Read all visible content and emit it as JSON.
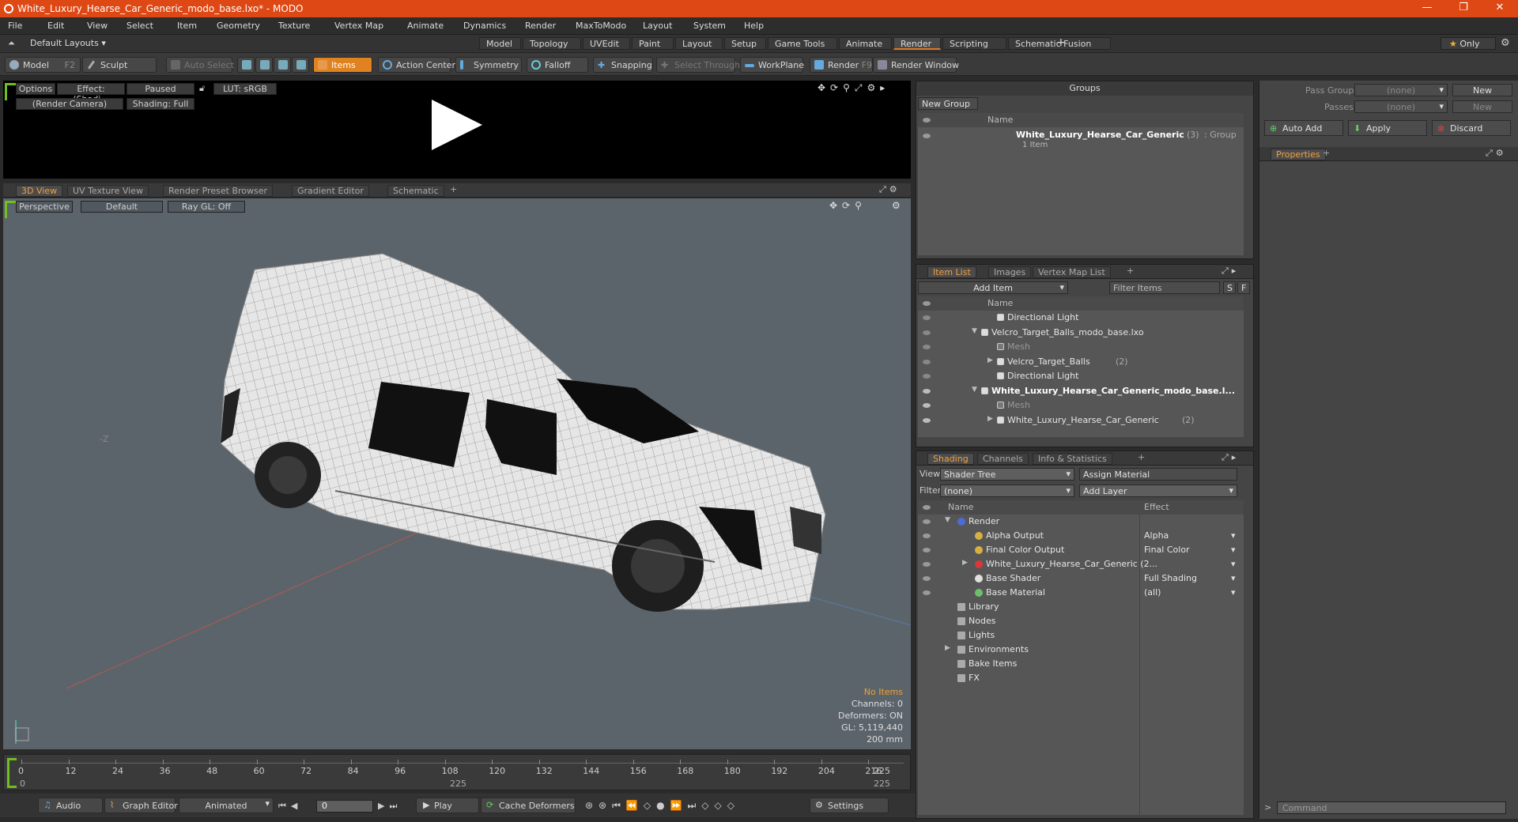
{
  "window": {
    "title": "White_Luxury_Hearse_Car_Generic_modo_base.lxo* - MODO",
    "min": "—",
    "max": "❐",
    "close": "✕"
  },
  "menu": [
    "File",
    "Edit",
    "View",
    "Select",
    "Item",
    "Geometry",
    "Texture",
    "Vertex Map",
    "Animate",
    "Dynamics",
    "Render",
    "MaxToModo",
    "Layout",
    "System",
    "Help"
  ],
  "layouts": {
    "label": "Default Layouts",
    "tabs": [
      "Model",
      "Topology",
      "UVEdit",
      "Paint",
      "Layout",
      "Setup",
      "Game Tools",
      "Animate",
      "Render",
      "Scripting",
      "Schematic Fusion"
    ],
    "active": "Render",
    "add": "+",
    "only": "Only"
  },
  "toolbar": {
    "model": "Model",
    "model_key": "F2",
    "sculpt": "Sculpt",
    "auto_select": "Auto Select",
    "items": "Items",
    "action_center": "Action Center",
    "symmetry": "Symmetry",
    "falloff": "Falloff",
    "snapping": "Snapping",
    "select_through": "Select Through",
    "workplane": "WorkPlane",
    "render": "Render",
    "render_key": "F9",
    "render_window": "Render Window"
  },
  "render_preview": {
    "options": "Options",
    "effect": "Effect: (Shadi...",
    "paused": "Paused",
    "lut": "LUT: sRGB",
    "camera": "(Render Camera)",
    "shading": "Shading: Full"
  },
  "view_tabs": [
    "3D View",
    "UV Texture View",
    "Render Preset Browser",
    "Gradient Editor",
    "Schematic"
  ],
  "viewport": {
    "perspective": "Perspective",
    "default": "Default",
    "raygl": "Ray GL: Off",
    "no_items": "No Items",
    "channels": "Channels: 0",
    "deformers": "Deformers: ON",
    "gl": "GL: 5,119,440",
    "scale": "200 mm",
    "axis_z": "-Z"
  },
  "timeline": {
    "ticks": [
      "0",
      "12",
      "24",
      "36",
      "48",
      "60",
      "72",
      "84",
      "96",
      "108",
      "120",
      "132",
      "144",
      "156",
      "168",
      "180",
      "192",
      "204",
      "216"
    ],
    "end_top": "225",
    "end_bot": "225",
    "end_mid": "225",
    "start": "0"
  },
  "bottombar": {
    "audio": "Audio",
    "graph_editor": "Graph Editor",
    "animated": "Animated",
    "frame": "0",
    "play": "Play",
    "cache": "Cache Deformers",
    "settings": "Settings"
  },
  "groups": {
    "title": "Groups",
    "new_group": "New Group",
    "name_col": "Name",
    "item_name": "White_Luxury_Hearse_Car_Generic",
    "item_count": "(3)",
    "item_type": ": Group",
    "item_sub": "1 Item"
  },
  "itemlist": {
    "tabs": [
      "Item List",
      "Images",
      "Vertex Map List"
    ],
    "add_item": "Add Item",
    "filter": "Filter Items",
    "s": "S",
    "f": "F",
    "name_col": "Name",
    "rows": [
      {
        "label": "Directional Light",
        "indent": 2,
        "bold": false,
        "dim": false,
        "suffix": ""
      },
      {
        "label": "Velcro_Target_Balls_modo_base.lxo",
        "indent": 1,
        "bold": false,
        "dim": false,
        "suffix": ""
      },
      {
        "label": "Mesh",
        "indent": 2,
        "bold": false,
        "dim": true,
        "suffix": ""
      },
      {
        "label": "Velcro_Target_Balls",
        "indent": 2,
        "bold": false,
        "dim": false,
        "suffix": "(2)"
      },
      {
        "label": "Directional Light",
        "indent": 2,
        "bold": false,
        "dim": false,
        "suffix": ""
      },
      {
        "label": "White_Luxury_Hearse_Car_Generic_modo_base.l...",
        "indent": 1,
        "bold": true,
        "dim": false,
        "suffix": ""
      },
      {
        "label": "Mesh",
        "indent": 2,
        "bold": false,
        "dim": true,
        "suffix": ""
      },
      {
        "label": "White_Luxury_Hearse_Car_Generic",
        "indent": 2,
        "bold": false,
        "dim": false,
        "suffix": "(2)"
      }
    ]
  },
  "shading": {
    "tabs": [
      "Shading",
      "Channels",
      "Info & Statistics"
    ],
    "view_label": "View",
    "view_value": "Shader Tree",
    "assign": "Assign Material",
    "filter_label": "Filter",
    "filter_value": "(none)",
    "add_layer": "Add Layer",
    "name_col": "Name",
    "effect_col": "Effect",
    "rows": [
      {
        "label": "Render",
        "effect": "",
        "indent": 1
      },
      {
        "label": "Alpha Output",
        "effect": "Alpha",
        "indent": 2
      },
      {
        "label": "Final Color Output",
        "effect": "Final Color",
        "indent": 2
      },
      {
        "label": "White_Luxury_Hearse_Car_Generic (2...",
        "effect": "",
        "indent": 2
      },
      {
        "label": "Base Shader",
        "effect": "Full Shading",
        "indent": 2
      },
      {
        "label": "Base Material",
        "effect": "(all)",
        "indent": 2
      },
      {
        "label": "Library",
        "effect": "",
        "indent": 1
      },
      {
        "label": "Nodes",
        "effect": "",
        "indent": 1
      },
      {
        "label": "Lights",
        "effect": "",
        "indent": 1
      },
      {
        "label": "Environments",
        "effect": "",
        "indent": 1
      },
      {
        "label": "Bake Items",
        "effect": "",
        "indent": 1
      },
      {
        "label": "FX",
        "effect": "",
        "indent": 1
      }
    ]
  },
  "right": {
    "pass_groups": "Pass Groups",
    "passes": "Passes",
    "none": "(none)",
    "new": "New",
    "auto_add": "Auto Add",
    "apply": "Apply",
    "discard": "Discard",
    "properties": "Properties",
    "command": "Command"
  }
}
